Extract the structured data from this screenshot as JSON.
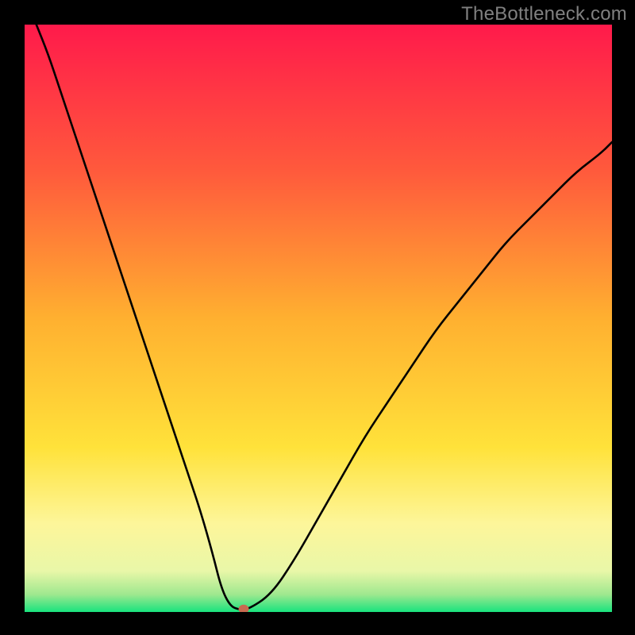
{
  "watermark": "TheBottleneck.com",
  "chart_data": {
    "type": "line",
    "title": "",
    "xlabel": "",
    "ylabel": "",
    "xlim": [
      0,
      100
    ],
    "ylim": [
      0,
      100
    ],
    "gradient_stops": [
      {
        "offset": 0,
        "color": "#ff1a4b"
      },
      {
        "offset": 25,
        "color": "#ff5a3c"
      },
      {
        "offset": 50,
        "color": "#ffb030"
      },
      {
        "offset": 72,
        "color": "#ffe23a"
      },
      {
        "offset": 85,
        "color": "#fdf69a"
      },
      {
        "offset": 93,
        "color": "#e9f7a8"
      },
      {
        "offset": 97,
        "color": "#9fe88f"
      },
      {
        "offset": 100,
        "color": "#19e37e"
      }
    ],
    "series": [
      {
        "name": "bottleneck-curve",
        "x": [
          0,
          2,
          4,
          6,
          8,
          10,
          12,
          14,
          16,
          18,
          20,
          22,
          24,
          26,
          28,
          30,
          32,
          33.5,
          35,
          36.5,
          38,
          42,
          46,
          50,
          54,
          58,
          62,
          66,
          70,
          74,
          78,
          82,
          86,
          90,
          94,
          98,
          100
        ],
        "y": [
          105,
          100,
          95,
          89,
          83,
          77,
          71,
          65,
          59,
          53,
          47,
          41,
          35,
          29,
          23,
          17,
          10,
          4,
          1,
          0.4,
          0.4,
          3,
          9,
          16,
          23,
          30,
          36,
          42,
          48,
          53,
          58,
          63,
          67,
          71,
          75,
          78,
          80
        ]
      }
    ],
    "marker": {
      "x": 37.3,
      "y": 0.5,
      "color": "#c96a50"
    }
  }
}
